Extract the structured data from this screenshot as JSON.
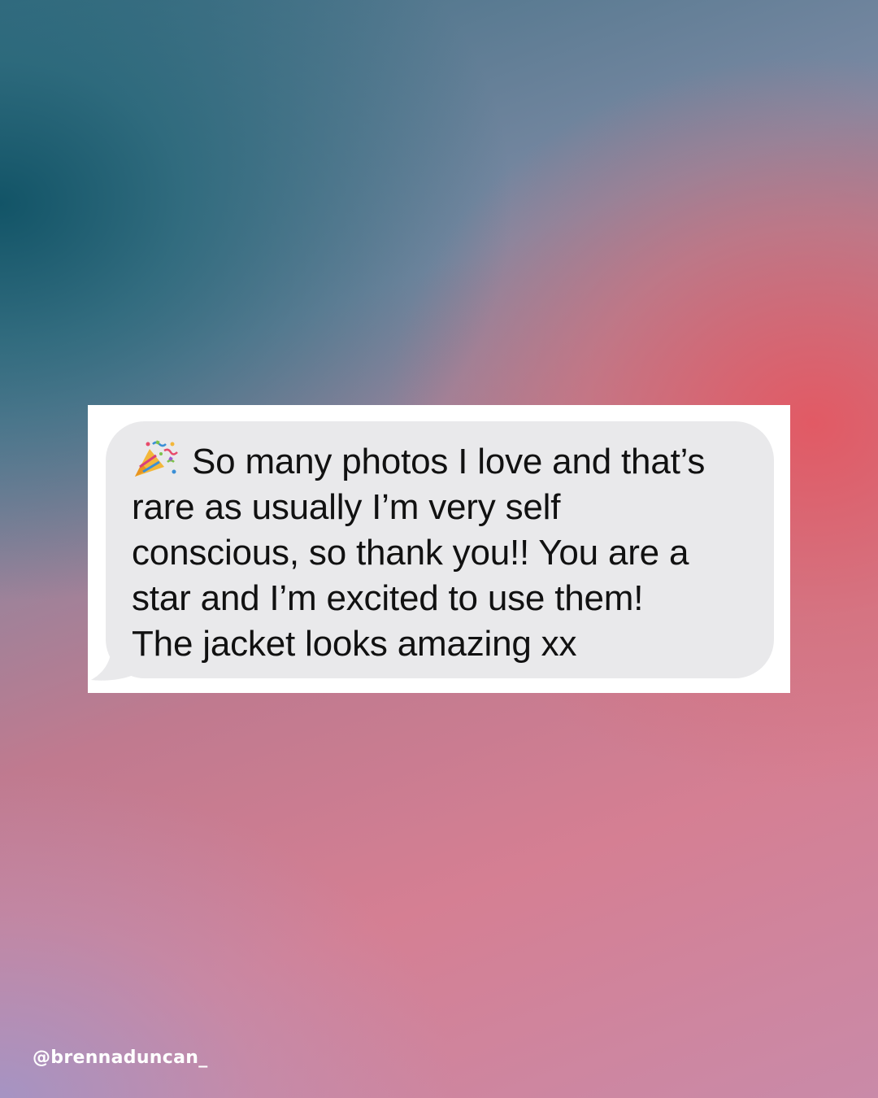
{
  "message": {
    "emoji_icon": "party-popper-icon",
    "lines": [
      "So many photos I love and that’s",
      "rare as usually I’m very self",
      "conscious, so thank you!! You are a",
      "star and I’m excited to use them!",
      "The jacket looks amazing xx"
    ]
  },
  "footer": {
    "handle": "@brennaduncan_"
  },
  "colors": {
    "bubble": "#e9e9eb",
    "card": "#ffffff",
    "text": "#111111",
    "handle": "#ffffff"
  }
}
